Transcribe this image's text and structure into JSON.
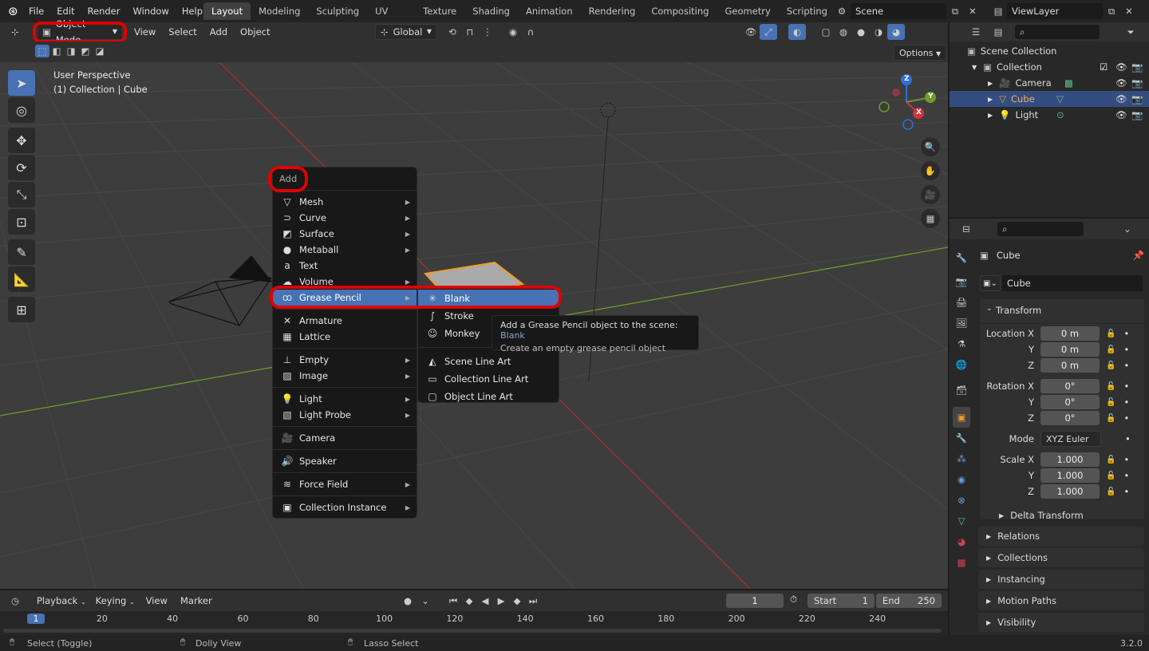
{
  "topbar": {
    "menus": [
      "File",
      "Edit",
      "Render",
      "Window",
      "Help"
    ],
    "workspaces": [
      "Layout",
      "Modeling",
      "Sculpting",
      "UV Editing",
      "Texture Paint",
      "Shading",
      "Animation",
      "Rendering",
      "Compositing",
      "Geometry Nodes",
      "Scripting"
    ],
    "active_workspace": "Layout",
    "scene": "Scene",
    "view_layer": "ViewLayer"
  },
  "viewport_header": {
    "mode": "Object Mode",
    "menus": [
      "View",
      "Select",
      "Add",
      "Object"
    ],
    "transform_orientation": "Global",
    "options": "Options"
  },
  "viewport": {
    "perspective": "User Perspective",
    "collection_info": "(1) Collection | Cube",
    "gizmo_labels": {
      "z": "Z",
      "y": "Y",
      "x": "X"
    }
  },
  "add_menu": {
    "title": "Add",
    "groups": [
      [
        {
          "label": "Mesh",
          "icon": "mesh-icon",
          "glyph": "▽",
          "submenu": true
        },
        {
          "label": "Curve",
          "icon": "curve-icon",
          "glyph": "⊃",
          "submenu": true
        },
        {
          "label": "Surface",
          "icon": "surface-icon",
          "glyph": "◩",
          "submenu": true
        },
        {
          "label": "Metaball",
          "icon": "metaball-icon",
          "glyph": "●",
          "submenu": true
        },
        {
          "label": "Text",
          "icon": "text-icon",
          "glyph": "a",
          "submenu": false
        },
        {
          "label": "Volume",
          "icon": "volume-icon",
          "glyph": "☁",
          "submenu": true
        },
        {
          "label": "Grease Pencil",
          "icon": "grease-pencil-icon",
          "glyph": "ꝏ",
          "submenu": true,
          "highlighted": true
        }
      ],
      [
        {
          "label": "Armature",
          "icon": "armature-icon",
          "glyph": "✕",
          "submenu": false
        },
        {
          "label": "Lattice",
          "icon": "lattice-icon",
          "glyph": "▦",
          "submenu": false
        }
      ],
      [
        {
          "label": "Empty",
          "icon": "empty-icon",
          "glyph": "⊥",
          "submenu": true
        },
        {
          "label": "Image",
          "icon": "image-icon",
          "glyph": "▨",
          "submenu": true
        }
      ],
      [
        {
          "label": "Light",
          "icon": "light-icon",
          "glyph": "💡",
          "submenu": true
        },
        {
          "label": "Light Probe",
          "icon": "light-probe-icon",
          "glyph": "▧",
          "submenu": true
        }
      ],
      [
        {
          "label": "Camera",
          "icon": "camera-icon",
          "glyph": "🎥",
          "submenu": false
        }
      ],
      [
        {
          "label": "Speaker",
          "icon": "speaker-icon",
          "glyph": "🔊",
          "submenu": false
        }
      ],
      [
        {
          "label": "Force Field",
          "icon": "force-field-icon",
          "glyph": "≋",
          "submenu": true
        }
      ],
      [
        {
          "label": "Collection Instance",
          "icon": "collection-instance-icon",
          "glyph": "▣",
          "submenu": true
        }
      ]
    ]
  },
  "grease_pencil_submenu": {
    "items": [
      {
        "label": "Blank",
        "glyph": "✳",
        "icon": "blank-icon",
        "highlighted": true
      },
      {
        "label": "Stroke",
        "glyph": "∫",
        "icon": "stroke-icon"
      },
      {
        "label": "Monkey",
        "glyph": "☺",
        "icon": "monkey-icon"
      }
    ],
    "lineart": [
      {
        "label": "Scene Line Art",
        "glyph": "◭",
        "icon": "scene-line-art-icon"
      },
      {
        "label": "Collection Line Art",
        "glyph": "▭",
        "icon": "collection-line-art-icon"
      },
      {
        "label": "Object Line Art",
        "glyph": "▢",
        "icon": "object-line-art-icon"
      }
    ]
  },
  "tooltip": {
    "line1": "Add a Grease Pencil object to the scene:",
    "line1_value": "Blank",
    "line2": "Create an empty grease pencil object"
  },
  "outliner": {
    "root": "Scene Collection",
    "collection": "Collection",
    "items": [
      {
        "label": "Camera",
        "selected": false
      },
      {
        "label": "Cube",
        "selected": true
      },
      {
        "label": "Light",
        "selected": false
      }
    ]
  },
  "properties": {
    "object_name": "Cube",
    "data_name": "Cube",
    "transform_title": "Transform",
    "location": {
      "label": "Location X",
      "x": "0 m",
      "y": "0 m",
      "z": "0 m"
    },
    "rotation": {
      "label": "Rotation X",
      "x": "0°",
      "y": "0°",
      "z": "0°"
    },
    "mode_label": "Mode",
    "mode_value": "XYZ Euler",
    "scale": {
      "label": "Scale X",
      "x": "1.000",
      "y": "1.000",
      "z": "1.000"
    },
    "axis_y": "Y",
    "axis_z": "Z",
    "delta": "Delta Transform",
    "sections": [
      "Relations",
      "Collections",
      "Instancing",
      "Motion Paths",
      "Visibility"
    ]
  },
  "timeline": {
    "menus": [
      "Playback",
      "Keying",
      "View",
      "Marker"
    ],
    "current_frame": "1",
    "start_label": "Start",
    "start": "1",
    "end_label": "End",
    "end": "250",
    "ruler": [
      "1",
      "20",
      "40",
      "60",
      "80",
      "100",
      "120",
      "140",
      "160",
      "180",
      "200",
      "220",
      "240"
    ]
  },
  "statusbar": {
    "left": "Select (Toggle)",
    "mid": "Dolly View",
    "right": "Lasso Select",
    "version": "3.2.0"
  },
  "colors": {
    "accent": "#4772b3",
    "highlight_red": "#e00000",
    "selected_orange": "#f09a2a",
    "x_axis": "#a3303a",
    "y_axis": "#6e9a2a"
  }
}
